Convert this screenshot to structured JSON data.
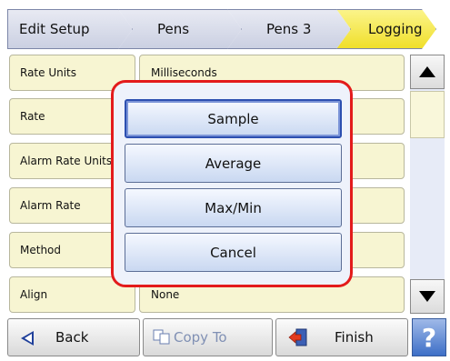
{
  "tabs": [
    "Edit Setup",
    "Pens",
    "Pens 3",
    "Logging"
  ],
  "rows": [
    {
      "label": "Rate Units",
      "value": "Milliseconds"
    },
    {
      "label": "Rate",
      "value": ""
    },
    {
      "label": "Alarm Rate Units",
      "value": ""
    },
    {
      "label": "Alarm Rate",
      "value": ""
    },
    {
      "label": "Method",
      "value": ""
    },
    {
      "label": "Align",
      "value": "None"
    }
  ],
  "popup": {
    "options": [
      "Sample",
      "Average",
      "Max/Min",
      "Cancel"
    ],
    "selected": "Sample"
  },
  "footer": {
    "back": "Back",
    "copy_to": "Copy To",
    "finish": "Finish",
    "help": "?"
  },
  "colors": {
    "highlight": "#e31b1b",
    "active_tab": "#f0df2a"
  }
}
